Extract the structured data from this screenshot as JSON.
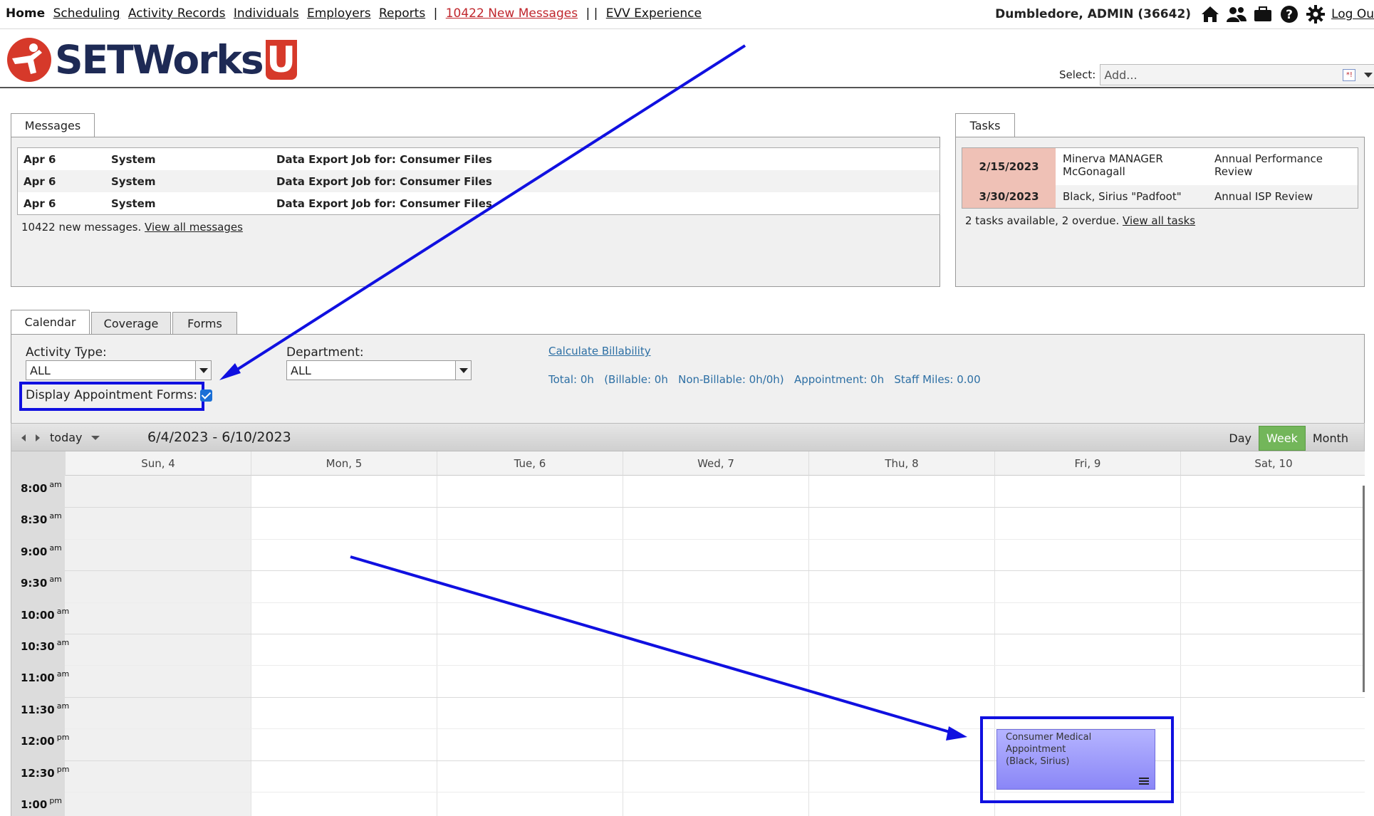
{
  "topnav": {
    "links": [
      "Home",
      "Scheduling",
      "Activity Records",
      "Individuals",
      "Employers",
      "Reports"
    ],
    "messages_link": "10422 New Messages",
    "evv_link": "EVV Experience",
    "user": "Dumbledore, ADMIN  (36642)",
    "logout": "Log Ou",
    "icons": [
      "home-icon",
      "users-icon",
      "briefcase-icon",
      "help-icon",
      "gear-icon"
    ]
  },
  "header": {
    "logo_text": "SETWorks",
    "logo_u": "U",
    "select_label": "Select:",
    "select_placeholder": "Add..."
  },
  "messages": {
    "tab": "Messages",
    "rows": [
      {
        "date": "Apr 6",
        "from": "System",
        "subject": "Data Export Job for: Consumer Files"
      },
      {
        "date": "Apr 6",
        "from": "System",
        "subject": "Data Export Job for: Consumer Files"
      },
      {
        "date": "Apr 6",
        "from": "System",
        "subject": "Data Export Job for: Consumer Files"
      }
    ],
    "footer_text": "10422 new messages.",
    "footer_link": "View all messages"
  },
  "tasks": {
    "tab": "Tasks",
    "rows": [
      {
        "date": "2/15/2023",
        "person": "Minerva MANAGER McGonagall",
        "task": "Annual Performance Review"
      },
      {
        "date": "3/30/2023",
        "person": "Black, Sirius \"Padfoot\"",
        "task": "Annual ISP Review"
      }
    ],
    "footer_text": "2 tasks available, 2 overdue.",
    "footer_link": "View all tasks"
  },
  "calendar_tabs": [
    "Calendar",
    "Coverage",
    "Forms"
  ],
  "filters": {
    "activity_type_label": "Activity Type:",
    "activity_type_value": "ALL",
    "department_label": "Department:",
    "department_value": "ALL",
    "display_forms_label": "Display Appointment Forms:",
    "display_forms_checked": true,
    "calc_link": "Calculate Billability",
    "totals": "Total: 0h   (Billable: 0h   Non-Billable: 0h/0h)   Appointment: 0h   Staff Miles: 0.00"
  },
  "calendar": {
    "today_label": "today",
    "range": "6/4/2023 - 6/10/2023",
    "views": [
      "Day",
      "Week",
      "Month"
    ],
    "active_view": "Week",
    "days": [
      "Sun, 4",
      "Mon, 5",
      "Tue, 6",
      "Wed, 7",
      "Thu, 8",
      "Fri, 9",
      "Sat, 10"
    ],
    "times": [
      {
        "t": "8:00",
        "m": "am"
      },
      {
        "t": "8:30",
        "m": "am"
      },
      {
        "t": "9:00",
        "m": "am"
      },
      {
        "t": "9:30",
        "m": "am"
      },
      {
        "t": "10:00",
        "m": "am"
      },
      {
        "t": "10:30",
        "m": "am"
      },
      {
        "t": "11:00",
        "m": "am"
      },
      {
        "t": "11:30",
        "m": "am"
      },
      {
        "t": "12:00",
        "m": "pm"
      },
      {
        "t": "12:30",
        "m": "pm"
      },
      {
        "t": "1:00",
        "m": "pm"
      }
    ],
    "event": {
      "title": "Consumer Medical Appointment",
      "subtitle": "(Black, Sirius)",
      "day": "Fri, 9",
      "start": "12:00 pm"
    }
  },
  "colors": {
    "accent": "#1010e0",
    "event": "#9d9bfb",
    "active_view": "#73b65a",
    "overdue": "#efc1b6",
    "link_red": "#c0272d"
  }
}
